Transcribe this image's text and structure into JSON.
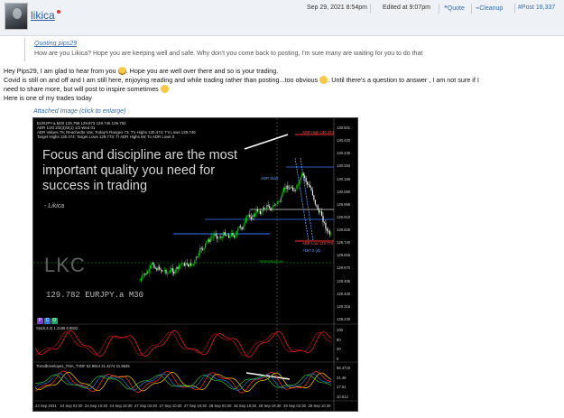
{
  "header": {
    "username": "likica",
    "date": "Sep 29, 2021 8:54pm",
    "edited": "Edited at 9:07pm",
    "quote_label": "Quote",
    "cleanup_label": "Cleanup",
    "post_number": "Post 18,337"
  },
  "quote": {
    "link_text": "Quoting pips29",
    "text": "How are you Likica? Hope you are keeping well and safe. Why don't you come back to posting, I'm sure many are waiting for you to do that"
  },
  "body": {
    "line1a": "Hey Pips29, I am glad to hear from you",
    "line1b": ". Hope you are well over there and so is your trading.",
    "line2a": "Covid is still on and off and I am still here, enjoying reading and while trading rather than posting...too obvious",
    "line2b": ". Until there's a question to answer , I am not sure if I",
    "line3": "need to share more, but will post to inspire sometimes",
    "line4": "Here is one of my trades today"
  },
  "attachment": {
    "label": "Attached Image (click to enlarge)",
    "chart": {
      "info_lines": [
        "EURJPY.a,M30  129.798 129.873 129.746 129.782",
        "ADR 1/20 2/2(3)/2(1) 1/2 Wed 01",
        "ADR Values 75; Reachedto Vas; Today's Ranges 73; T's Highs 130.474; T's Lows 129.746",
        "Target Highs 130.474; Target Lows 129.773; T/ ADR Highs 69; To ADR Lows 0"
      ],
      "overlay_text": "Focus and discipline are the most important quality you need for success in trading",
      "signature": "- Likica",
      "watermark": "LKC",
      "price_symbol": "129.782  EURJPY.a M30",
      "adr_high": "ADR High  130.474",
      "adr_low": "ADR Low  129.773",
      "adr_start": "ADR Start",
      "yesterday_low": "YesterdayLow",
      "target": "+157.0 (4)",
      "stoch_label": "Sto(8,3,3)  1.3166  6.9822",
      "trend_label": "TrendEnvelopes_TMA_TVDF 52.9914 21.4274 31.5625",
      "y_ticks": [
        "130.501",
        "130.420",
        "130.335",
        "130.250",
        "130.165",
        "130.080",
        "129.995",
        "129.910",
        "129.825",
        "129.740",
        "129.655",
        "129.570",
        "129.485",
        "129.400",
        "129.315",
        "129.230"
      ],
      "stoch_ticks": [
        "100",
        "80",
        "20",
        "0"
      ],
      "trend_ticks": [
        "56.4719",
        "31.49",
        "17.51",
        "10.512"
      ],
      "x_ticks": [
        "23 Sep 2021",
        "24 Sep 02:30",
        "24 Sep 10:30",
        "24 Sep 18:30",
        "27 Sep 02:30",
        "27 Sep 10:30",
        "27 Sep 18:30",
        "28 Sep 02:30",
        "28 Sep 10:30",
        "28 Sep 18:30",
        "29 Sep 02:30",
        "29 Sep 10:30"
      ]
    }
  },
  "colors": {
    "link": "#3c6ea8",
    "header_bg": "#eef1f5",
    "bull_candle": "#00e000",
    "bear_candle": "#ffffff",
    "adr_high": "#ff3030",
    "stoch_line": "#ff2020"
  }
}
